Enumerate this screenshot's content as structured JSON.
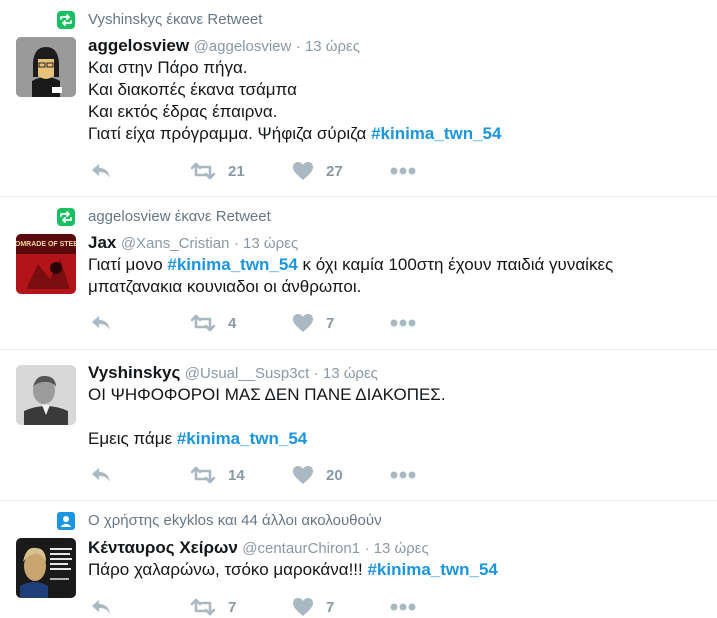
{
  "tweets": [
    {
      "context": "Vyshinskyς έκανε Retweet",
      "context_icon": "retweet-icon",
      "fullname": "aggelosview",
      "handle": "@aggelosview",
      "time": "· 13 ώρες",
      "lines": [
        "Και στην Πάρο πήγα.",
        "Και διακοπές έκανα τσάμπα",
        "Και εκτός έδρας έπαιρνα.",
        "Γιατί είχα πρόγραμμα. Ψήφιζα σύριζα "
      ],
      "hashtag": "#kinima_twn_54",
      "retweets": "21",
      "likes": "27"
    },
    {
      "context": "aggelosview έκανε Retweet",
      "context_icon": "retweet-icon",
      "fullname": "Jax",
      "handle": "@Xans_Cristian",
      "time": "· 13 ώρες",
      "line1_pre": "Γιατί μονο ",
      "hashtag": "#kinima_twn_54",
      "line1_post": " κ όχι καμία 100στη έχουν παιδιά γυναίκες",
      "line2": "μπατζανακια κουνιαδοι οι άνθρωποι.",
      "avatar_text": "COMRADE OF STEEL",
      "retweets": "4",
      "likes": "7"
    },
    {
      "fullname": "Vyshinskyς",
      "handle": "@Usual__Susp3ct",
      "time": "· 13 ώρες",
      "line1": "ΟΙ ΨΗΦΟΦΟΡΟΙ ΜΑΣ ΔΕΝ ΠΑΝΕ ΔΙΑΚΟΠΕΣ.",
      "line2_pre": "Εμεις πάμε  ",
      "hashtag": "#kinima_twn_54",
      "retweets": "14",
      "likes": "20"
    },
    {
      "context": "Ο χρήστης ekyklos και 44 άλλοι ακολουθούν",
      "context_icon": "user-icon",
      "fullname": "Κένταυρος Χείρων",
      "handle": "@centaurChiron1",
      "time": "· 13 ώρες",
      "line1_pre": "Πάρο χαλαρώνω, τσόκο μαροκάνα!!! ",
      "hashtag": "#kinima_twn_54",
      "retweets": "7",
      "likes": "7"
    }
  ],
  "colors": {
    "accent": "#1b95e0",
    "retweet_green": "#17bf63",
    "muted": "#8899a6",
    "action_icon": "#aab8c2"
  }
}
